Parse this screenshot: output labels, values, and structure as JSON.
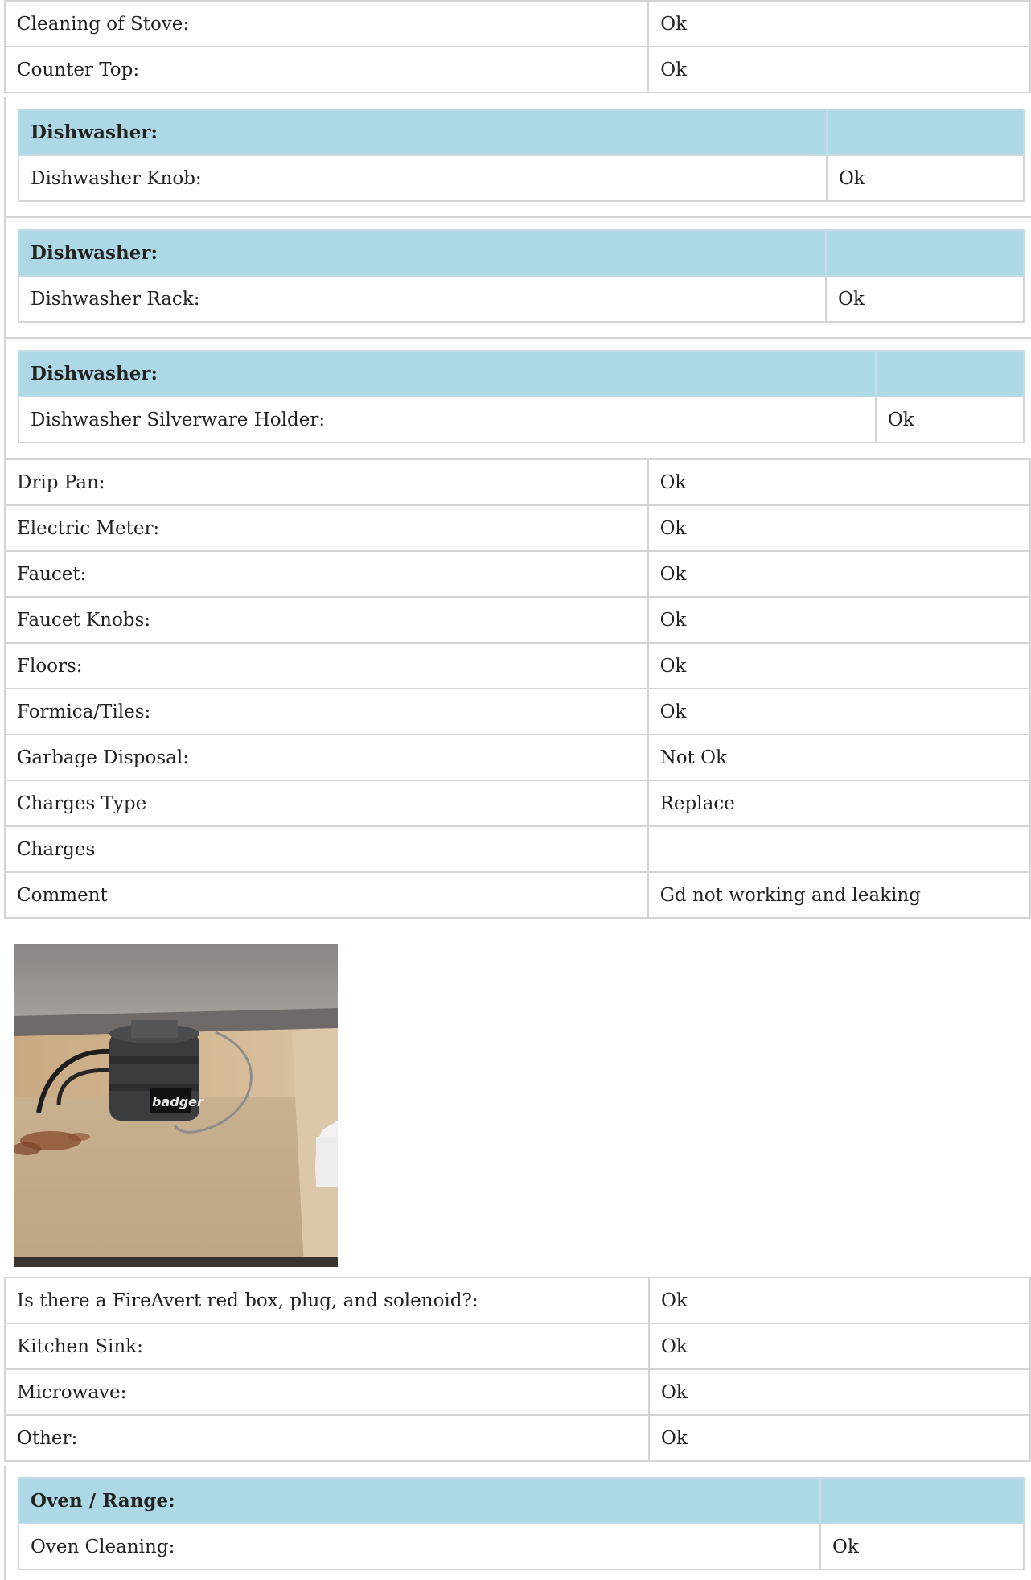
{
  "rows_top": [
    {
      "label": "Cleaning of Stove:",
      "value": "Ok"
    },
    {
      "label": "Counter Top:",
      "value": "Ok"
    }
  ],
  "dishwasher_sections": [
    {
      "header": "Dishwasher:",
      "label": "Dishwasher Knob:",
      "value": "Ok"
    },
    {
      "header": "Dishwasher:",
      "label": "Dishwasher Rack:",
      "value": "Ok"
    },
    {
      "header": "Dishwasher:",
      "label": "Dishwasher Silverware Holder:",
      "value": "Ok"
    }
  ],
  "rows_middle": [
    {
      "label": "Drip Pan:",
      "value": "Ok"
    },
    {
      "label": "Electric Meter:",
      "value": "Ok"
    },
    {
      "label": "Faucet:",
      "value": "Ok"
    },
    {
      "label": "Faucet Knobs:",
      "value": "Ok"
    },
    {
      "label": "Floors:",
      "value": "Ok"
    },
    {
      "label": "Formica/Tiles:",
      "value": "Ok"
    },
    {
      "label": "Garbage Disposal:",
      "value": "Not Ok"
    },
    {
      "label": "Charges Type",
      "value": "Replace"
    },
    {
      "label": "Charges",
      "value": ""
    },
    {
      "label": "Comment",
      "value": "Gd not working and leaking"
    }
  ],
  "photo": {
    "icon": "garbage-disposal-photo",
    "label_text": "badger"
  },
  "rows_bottom": [
    {
      "label": "Is there a FireAvert red box, plug, and solenoid?:",
      "value": "Ok"
    },
    {
      "label": "Kitchen Sink:",
      "value": "Ok"
    },
    {
      "label": "Microwave:",
      "value": "Ok"
    },
    {
      "label": "Other:",
      "value": "Ok"
    }
  ],
  "oven_section": {
    "header": "Oven / Range:",
    "label": "Oven Cleaning:",
    "value": "Ok"
  },
  "colors": {
    "section_header_bg": "#add8e6",
    "border": "#d4d4d4"
  }
}
